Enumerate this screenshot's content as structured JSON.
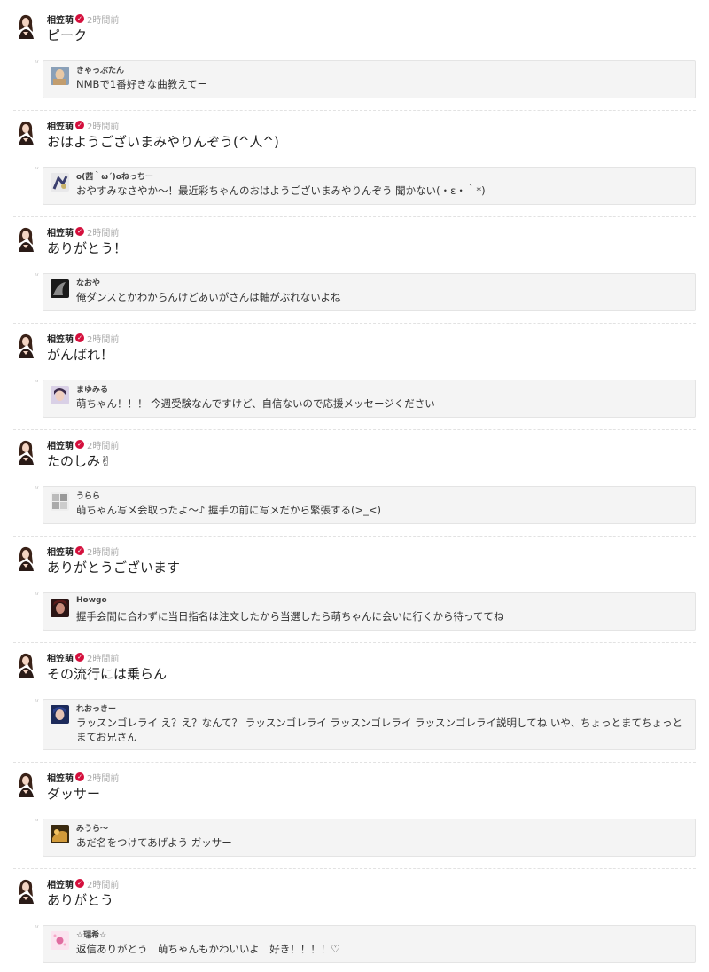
{
  "author": {
    "name": "相笠萌",
    "verified_icon": "check-icon",
    "verified_color": "#d40f3c",
    "time": "2時間前"
  },
  "posts": [
    {
      "reply": "ピーク",
      "quote": {
        "name": "きゃっぷたん",
        "text": "NMBで1番好きな曲教えてー"
      }
    },
    {
      "reply": "おはようございまみやりんぞう(^人^)",
      "quote": {
        "name": "o(茜｀ω´)oねっちー",
        "text": "おやすみなさやか〜！最近彩ちゃんのおはようございまみやりんぞう 聞かない(・ε・｀*)"
      }
    },
    {
      "reply": "ありがとう！",
      "quote": {
        "name": "なおや",
        "text": "俺ダンスとかわからんけどあいがさんは軸がぶれないよね"
      }
    },
    {
      "reply": "がんばれ！",
      "quote": {
        "name": "まゆみる",
        "text": "萌ちゃん！！！ 今週受験なんですけど、自信ないので応援メッセージください"
      }
    },
    {
      "reply": "たのしみ✌",
      "quote": {
        "name": "うらら",
        "text": "萌ちゃん写メ会取ったよ～♪ 握手の前に写メだから緊張する(>_<)"
      }
    },
    {
      "reply": "ありがとうございます",
      "quote": {
        "name": "Howgo",
        "text": "握手会間に合わずに当日指名は注文したから当選したら萌ちゃんに会いに行くから待っててね"
      }
    },
    {
      "reply": "その流行には乗らん",
      "quote": {
        "name": "れおっきー",
        "text": "ラッスンゴレライ え？え？なんて？ ラッスンゴレライ ラッスンゴレライ ラッスンゴレライ説明してね いや、ちょっとまてちょっとまてお兄さん"
      }
    },
    {
      "reply": "ダッサー",
      "quote": {
        "name": "みうら～",
        "text": "あだ名をつけてあげよう ガッサー"
      }
    },
    {
      "reply": "ありがとう",
      "quote": {
        "name": "☆瑞希☆",
        "text": "返信ありがとう　萌ちゃんもかわいいよ　好き！！！！♡"
      }
    }
  ]
}
